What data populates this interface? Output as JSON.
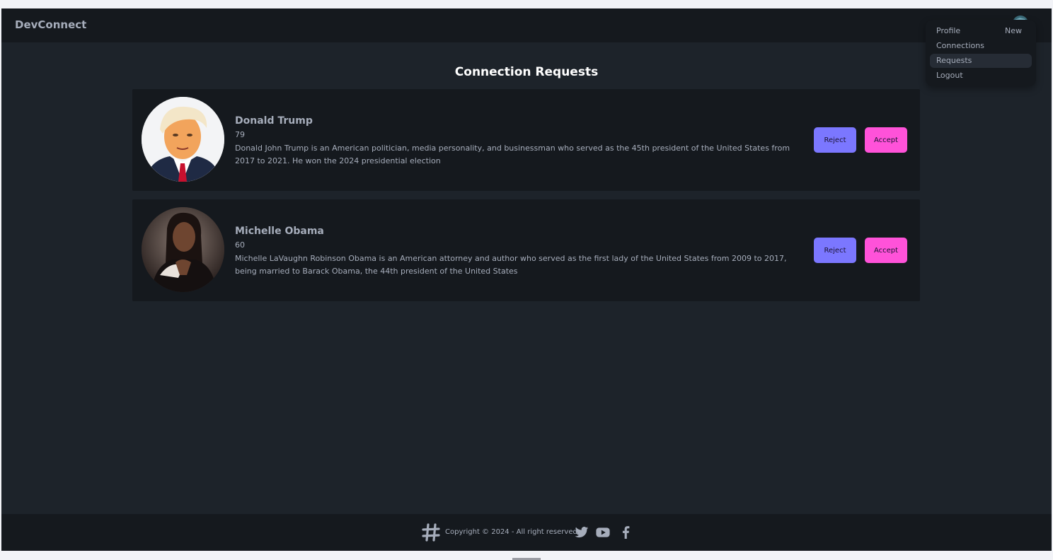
{
  "navbar": {
    "brand": "DevConnect"
  },
  "menu": {
    "items": [
      {
        "label": "Profile",
        "badge": "New"
      },
      {
        "label": "Connections"
      },
      {
        "label": "Requests",
        "active": true
      },
      {
        "label": "Logout"
      }
    ]
  },
  "main": {
    "title": "Connection Requests",
    "requests": [
      {
        "name": "Donald Trump",
        "age": "79",
        "about": "Donald John Trump is an American politician, media personality, and businessman who served as the 45th president of the United States from 2017 to 2021. He won the 2024 presidential election",
        "reject_label": "Reject",
        "accept_label": "Accept"
      },
      {
        "name": "Michelle Obama",
        "age": "60",
        "about": "Michelle LaVaughn Robinson Obama is an American attorney and author who served as the first lady of the United States from 2009 to 2017, being married to Barack Obama, the 44th president of the United States",
        "reject_label": "Reject",
        "accept_label": "Accept"
      }
    ]
  },
  "footer": {
    "copyright": "Copyright © 2024 - All right reserved"
  },
  "icons": [
    "hash-logo-icon",
    "twitter-icon",
    "youtube-icon",
    "facebook-icon"
  ],
  "colors": {
    "reject": "#7b77ff",
    "accept": "#ff52d9",
    "background": "#1d232a",
    "surface": "#15191e"
  }
}
